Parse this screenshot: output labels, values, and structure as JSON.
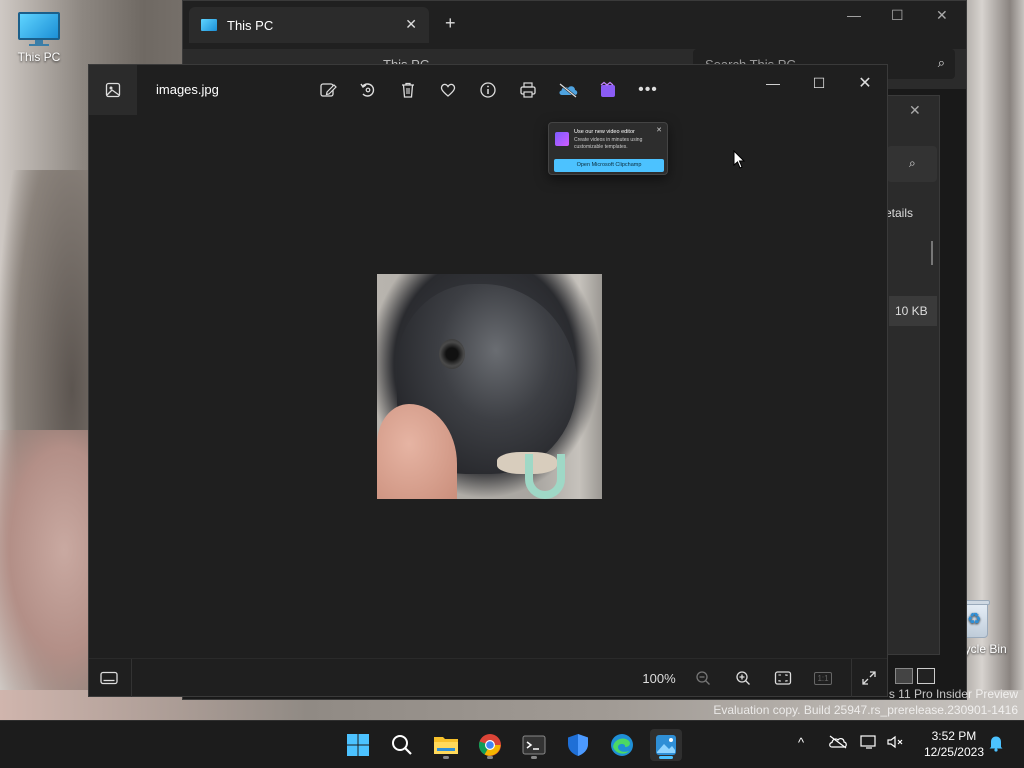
{
  "desktop": {
    "this_pc_label": "This PC",
    "recycle_bin_label": "Recycle Bin"
  },
  "explorer": {
    "tab_title": "This PC",
    "breadcrumb": "This PC",
    "search_placeholder": "Search This PC"
  },
  "dialog": {
    "details_label": "etails",
    "size_value": "10 KB"
  },
  "photos": {
    "filename": "images.jpg",
    "zoom": "100%",
    "actual_size_label": "1:1"
  },
  "teaching_tip": {
    "title": "Use our new video editor",
    "body": "Create videos in minutes using customizable templates.",
    "button": "Open Microsoft Clipchamp"
  },
  "watermark": {
    "line1": "s 11 Pro Insider Preview",
    "line2": "Evaluation copy. Build 25947.rs_prerelease.230901-1416"
  },
  "taskbar": {
    "time": "3:52 PM",
    "date": "12/25/2023",
    "apps": [
      "start",
      "search",
      "file-explorer",
      "chrome",
      "terminal",
      "security",
      "edge",
      "photos"
    ]
  },
  "colors": {
    "accent": "#4cc2ff",
    "window_bg": "#1f1f1f",
    "taskbar_bg": "#1c1c1c"
  }
}
